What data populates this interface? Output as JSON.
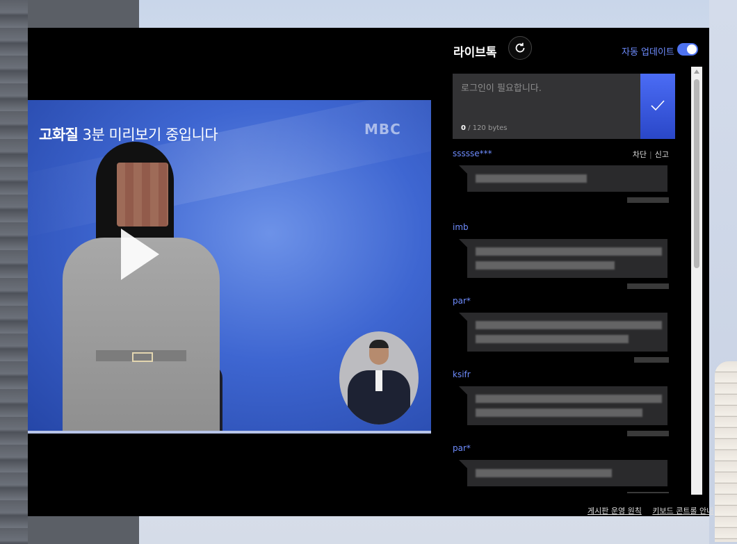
{
  "video": {
    "preview_bold": "고화질",
    "preview_rest": " 3분 미리보기 중입니다",
    "channel_logo": "MBC"
  },
  "chat": {
    "title": "라이브톡",
    "auto_update_label": "자동 업데이트",
    "auto_update_on": true,
    "input": {
      "placeholder": "로그인이 필요합니다.",
      "count": "0",
      "limit": "/ 120 bytes"
    },
    "messages": [
      {
        "user": "ssssse***",
        "block": "차단",
        "report": "신고"
      },
      {
        "user": "imb",
        "block": "",
        "report": ""
      },
      {
        "user": "par*",
        "block": "",
        "report": ""
      },
      {
        "user": "ksifr",
        "block": "",
        "report": ""
      },
      {
        "user": "par*",
        "block": "",
        "report": ""
      }
    ],
    "footer": {
      "rules": "게시판 운영 원칙",
      "keyboard": "키보드 콘트롤 안내"
    }
  },
  "colors": {
    "accent": "#4e73f0",
    "username": "#6f8dff",
    "background": "#000000"
  }
}
